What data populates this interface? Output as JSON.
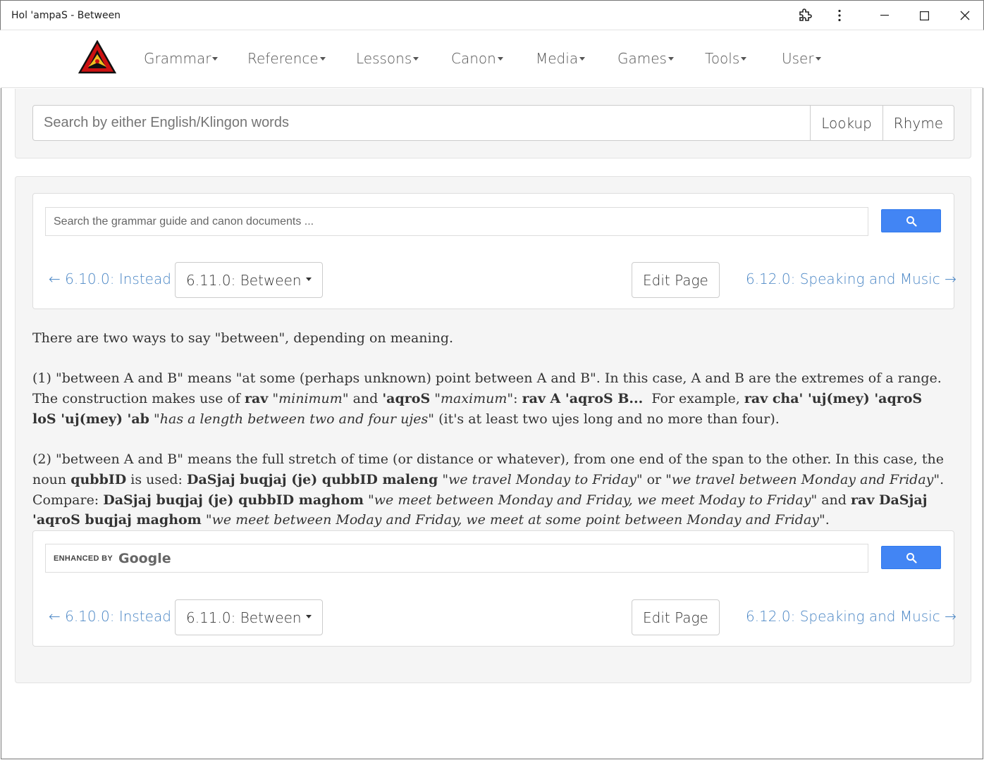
{
  "window": {
    "title": "Hol 'ampaS - Between"
  },
  "nav": {
    "items": [
      {
        "label": "Grammar"
      },
      {
        "label": "Reference"
      },
      {
        "label": "Lessons"
      },
      {
        "label": "Canon"
      },
      {
        "label": "Media"
      },
      {
        "label": "Games"
      },
      {
        "label": "Tools"
      },
      {
        "label": "User"
      }
    ]
  },
  "lookup": {
    "placeholder": "Search by either English/Klingon words",
    "lookup_label": "Lookup",
    "rhyme_label": "Rhyme"
  },
  "grammar_search": {
    "placeholder": "Search the grammar guide and canon documents ...",
    "enhanced_by": "ENHANCED BY",
    "google": "Google"
  },
  "section_nav": {
    "prev": "← 6.10.0: Instead",
    "current": "6.11.0: Between",
    "edit": "Edit Page",
    "next": "6.12.0: Speaking and Music →"
  },
  "content": {
    "intro": "There are two ways to say \"between\", depending on meaning.",
    "p1": {
      "a": "(1) \"between A and B\" means \"at some (perhaps unknown) point between A and B\". In this case, A and B are the extremes of a range. The construction makes use of ",
      "rav": "rav",
      "b": " \"",
      "minimum": "minimum",
      "c": "\" and ",
      "aqros": "'aqroS",
      "d": " \"",
      "maximum": "maximum",
      "e": "\": ",
      "pattern": "rav A 'aqroS B...",
      "f": "  For example, ",
      "example": "rav cha' 'uj(mey) 'aqroS loS 'uj(mey) 'ab",
      "g": " \"",
      "gloss": "has a length between two and four ujes",
      "h": "\" (it's at least two ujes long and no more than four)."
    },
    "p2": {
      "a": "(2) \"between A and B\" means the full stretch of time (or distance or whatever), from one end of the span to the other. In this case, the noun ",
      "qubbid": "qubbID",
      "b": " is used: ",
      "ex1": "DaSjaj buqjaj (je) qubbID maleng",
      "c": " \"",
      "gloss1": "we travel Monday to Friday",
      "d": "\" or \"",
      "gloss2": "we travel between Monday and Friday",
      "e": "\". Compare: ",
      "ex2": "DaSjaj buqjaj (je) qubbID maghom",
      "f": " \"",
      "gloss3": "we meet between Monday and Friday, we meet Moday to Friday",
      "g": "\" and ",
      "ex3": "rav DaSjaj 'aqroS buqjaj maghom",
      "h": " \"",
      "gloss4": "we meet between Moday and Friday, we meet at some point between Monday and Friday",
      "i": "\"."
    }
  }
}
